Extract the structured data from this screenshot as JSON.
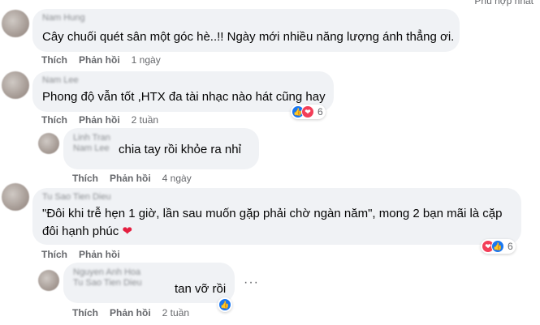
{
  "header": {
    "top_right_text": "Phù hợp nhất"
  },
  "actions": {
    "like": "Thích",
    "reply": "Phản hồi"
  },
  "comments": [
    {
      "author": "Nam Hung",
      "text": "Cây chuối quét sân một góc hè..!! Ngày mới nhiều năng lượng ánh thẳng ơi.",
      "time": "1 ngày"
    },
    {
      "author": "Nam Lee",
      "text": "Phong độ vẫn tốt ,HTX đa tài nhạc nào hát cũng hay",
      "time": "2 tuần",
      "reactions": {
        "icons": [
          "like-icon",
          "love-icon"
        ],
        "count": "6"
      }
    },
    {
      "author": "Linh Tran",
      "mention": "Nam Lee",
      "text": "chia tay rồi khỏe ra nhỉ",
      "time": "4 ngày"
    },
    {
      "author": "Tu Sao Tien Dieu",
      "text_line1": "\"Đôi khi trễ hẹn 1 giờ, lần sau muốn gặp phải chờ ngàn năm\", mong 2 bạn mãi là cặp",
      "text_line2": "đôi hạnh phúc",
      "emoji": "❤",
      "time": "",
      "reactions": {
        "icons": [
          "love-icon",
          "like-icon"
        ],
        "count": "6"
      }
    },
    {
      "author": "Nguyen Anh Hoa",
      "mention": "Tu Sao Tien Dieu",
      "text": "tan vỡ rồi",
      "time": "2 tuần",
      "reactions": {
        "icons": [
          "like-icon"
        ],
        "count": ""
      },
      "more_icon": "more-dots-icon"
    }
  ],
  "colors": {
    "bubble": "#f0f2f5",
    "like_blue": "#1877f2",
    "love_red": "#f33e58",
    "meta_gray": "#65676b"
  }
}
